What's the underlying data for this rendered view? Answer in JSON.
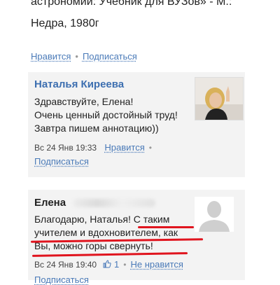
{
  "post": {
    "text_line1": "астрономии: Учебник для ВУЗов» - М.:",
    "text_line2": "Недра, 1980г",
    "like_label": "Нравится",
    "subscribe_label": "Подписаться"
  },
  "comments": [
    {
      "author": "Наталья Киреева",
      "lines": [
        "Здравствуйте, Елена!",
        "Очень ценный достойный труд!",
        "Завтра пишем аннотацию))"
      ],
      "date": "Вс 24 Янв 19:33",
      "like_label": "Нравится",
      "reply_label": "Подписаться"
    },
    {
      "author": "Елена",
      "lines": [
        "Благодарю, Наталья! С таким",
        "учителем и вдохновителем, как",
        "Вы, можно горы свернуть!"
      ],
      "date": "Вс 24 Янв 19:40",
      "like_count": "1",
      "dislike_label": "Не нравится",
      "reply_label": "Подписаться"
    }
  ],
  "colors": {
    "link": "#4a7ab8",
    "author": "#3d6fb0",
    "card_bg": "#f3f3f3",
    "highlight": "#e0141e"
  },
  "icons": {
    "like": "thumbs-up-icon",
    "default_avatar": "user-silhouette-icon"
  }
}
